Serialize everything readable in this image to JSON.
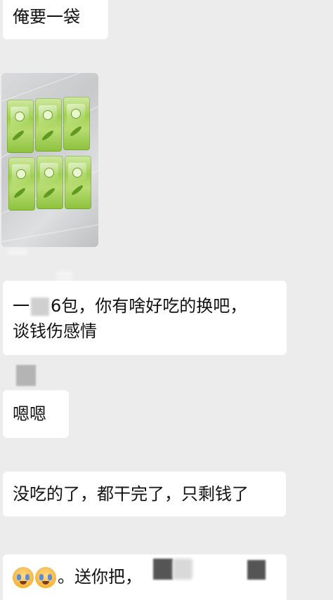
{
  "chat": {
    "messages": [
      {
        "type": "text",
        "text": "俺要一袋"
      },
      {
        "type": "image",
        "alt_icon": "tissue-pack-photo"
      },
      {
        "type": "text",
        "parts": [
          "一",
          "6包，你有啥好吃的换吧，",
          "谈钱伤感情"
        ]
      },
      {
        "type": "text",
        "text": "嗯嗯"
      },
      {
        "type": "text",
        "text": "没吃的了，都干完了，只剩钱了"
      },
      {
        "type": "text",
        "parts": [
          "。送你把，"
        ],
        "emoji": [
          "crying-face-emoji",
          "crying-face-emoji"
        ]
      }
    ]
  },
  "colors": {
    "background": "#ececec",
    "bubble": "#ffffff",
    "pack_green": "#9fd04f"
  }
}
